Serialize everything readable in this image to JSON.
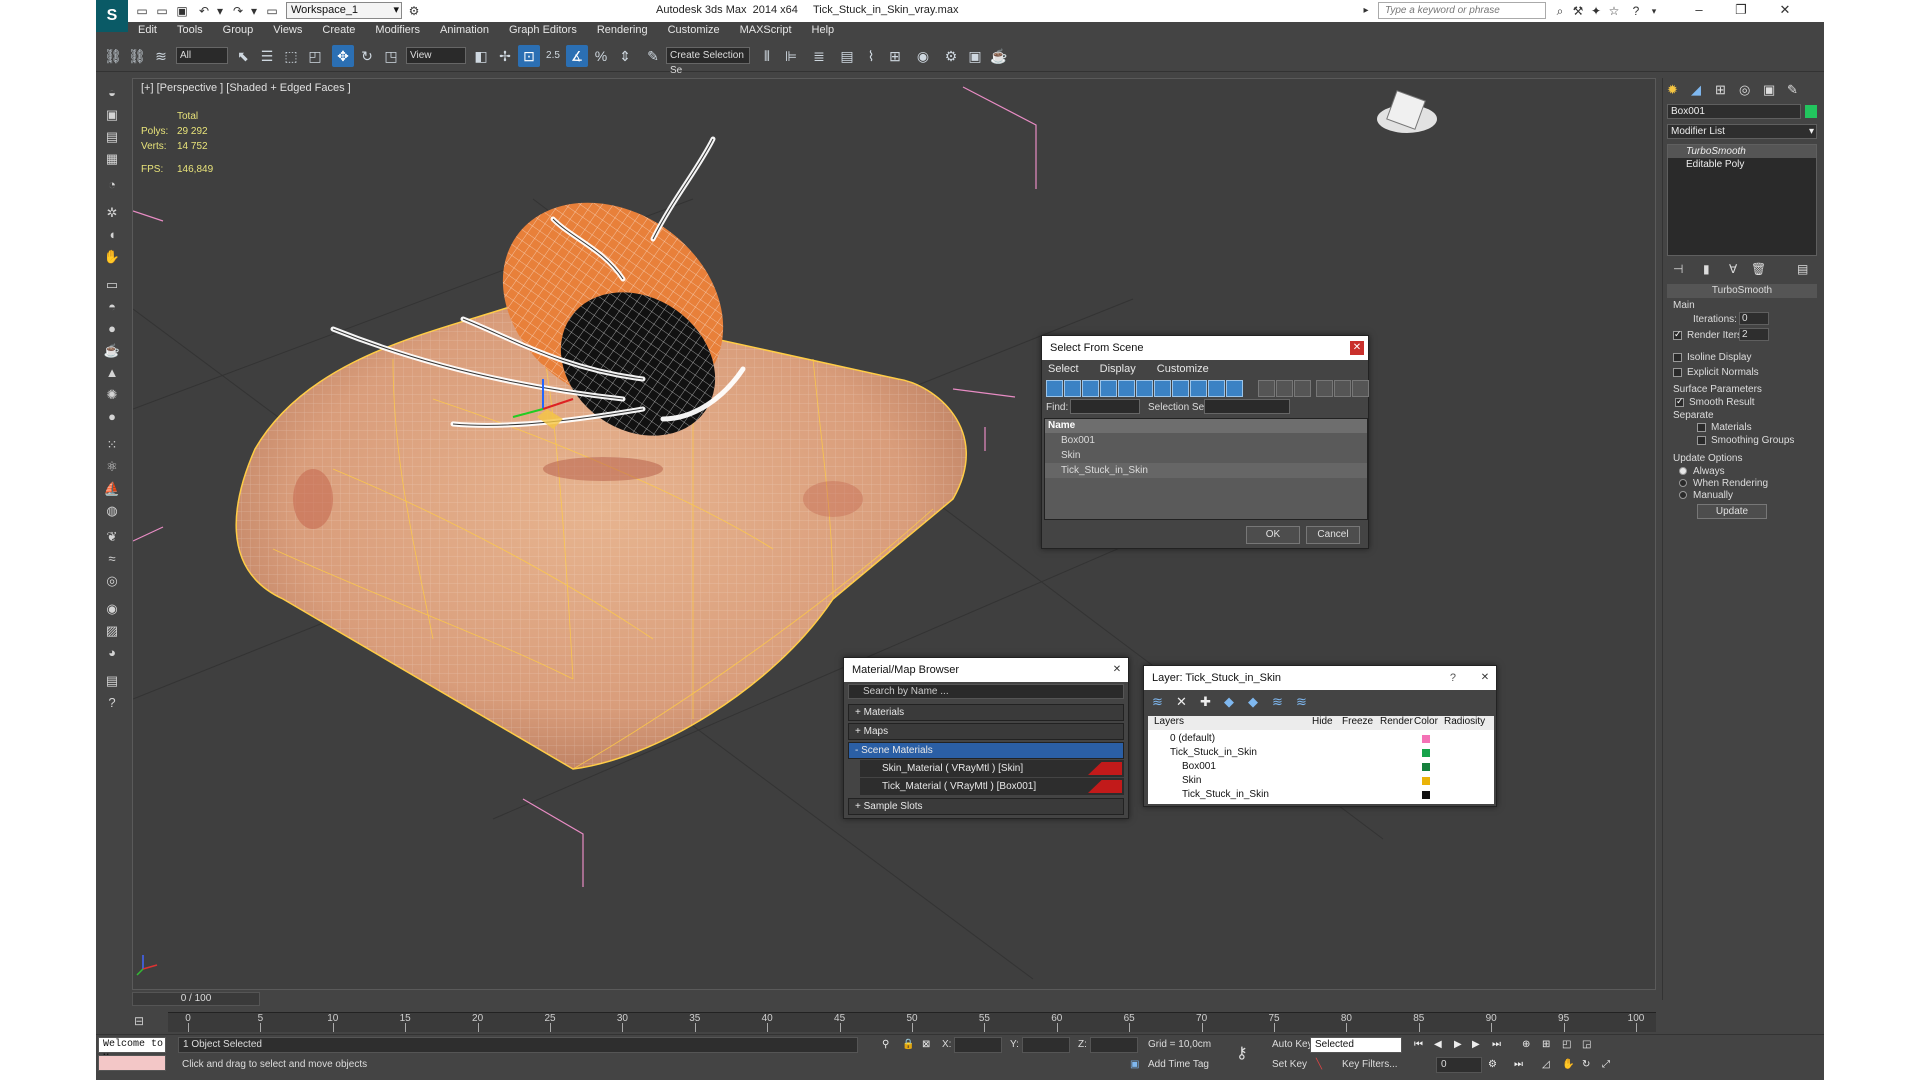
{
  "app": {
    "title": "Autodesk 3ds Max  2014 x64     Tick_Stuck_in_Skin_vray.max",
    "workspace": "Workspace_1",
    "search_placeholder": "Type a keyword or phrase"
  },
  "menu": [
    "Edit",
    "Tools",
    "Group",
    "Views",
    "Create",
    "Modifiers",
    "Animation",
    "Graph Editors",
    "Rendering",
    "Customize",
    "MAXScript",
    "Help"
  ],
  "toolbar": {
    "filter": "All",
    "ref_coord": "View",
    "snap_angle": "2.5",
    "selection_set": "Create Selection Se"
  },
  "viewport": {
    "label": "[+] [Perspective ] [Shaded + Edged Faces ]",
    "stats": {
      "header": "Total",
      "polys_label": "Polys:",
      "polys": "29 292",
      "verts_label": "Verts:",
      "verts": "14 752",
      "fps_label": "FPS:",
      "fps": "146,849"
    }
  },
  "command_panel": {
    "object_name": "Box001",
    "object_color": "#22c55e",
    "modifier_list": "Modifier List",
    "stack": [
      "TurboSmooth",
      "Editable Poly"
    ],
    "rollout_title": "TurboSmooth",
    "main_label": "Main",
    "iterations_label": "Iterations:",
    "iterations": "0",
    "render_iters_label": "Render Iters:",
    "render_iters": "2",
    "isoline": "Isoline Display",
    "explicit_normals": "Explicit Normals",
    "surface_params": "Surface Parameters",
    "smooth_result": "Smooth Result",
    "separate": "Separate",
    "materials": "Materials",
    "smoothing_groups": "Smoothing Groups",
    "update_options": "Update Options",
    "always": "Always",
    "when_rendering": "When Rendering",
    "manually": "Manually",
    "update_btn": "Update"
  },
  "select_from_scene": {
    "title": "Select From Scene",
    "menu": [
      "Select",
      "Display",
      "Customize"
    ],
    "find_label": "Find:",
    "selection_set_label": "Selection Set:",
    "column": "Name",
    "items": [
      "Box001",
      "Skin",
      "Tick_Stuck_in_Skin"
    ],
    "ok": "OK",
    "cancel": "Cancel"
  },
  "material_browser": {
    "title": "Material/Map Browser",
    "search_placeholder": "Search by Name ...",
    "groups": [
      "+ Materials",
      "+ Maps",
      "- Scene Materials"
    ],
    "materials": [
      "Skin_Material  ( VRayMtl )  [Skin]",
      "Tick_Material  ( VRayMtl )  [Box001]"
    ],
    "sample_slots": "+ Sample Slots"
  },
  "layer_dialog": {
    "title": "Layer: Tick_Stuck_in_Skin",
    "help": "?",
    "columns": [
      "Layers",
      "Hide",
      "Freeze",
      "Render",
      "Color",
      "Radiosity"
    ],
    "rows": [
      {
        "name": "0 (default)",
        "color": "#f472b6",
        "indent": 0
      },
      {
        "name": "Tick_Stuck_in_Skin",
        "color": "#16a34a",
        "indent": 0
      },
      {
        "name": "Box001",
        "color": "#15803d",
        "indent": 1
      },
      {
        "name": "Skin",
        "color": "#eab308",
        "indent": 1
      },
      {
        "name": "Tick_Stuck_in_Skin",
        "color": "#111111",
        "indent": 1
      }
    ]
  },
  "timeline": {
    "frame": "0 / 100",
    "ticks": [
      "0",
      "5",
      "10",
      "15",
      "20",
      "25",
      "30",
      "35",
      "40",
      "45",
      "50",
      "55",
      "60",
      "65",
      "70",
      "75",
      "80",
      "85",
      "90",
      "95",
      "100"
    ]
  },
  "status": {
    "script": "Welcome to M",
    "selected": "1 Object Selected",
    "prompt": "Click and drag to select and move objects",
    "x_label": "X:",
    "y_label": "Y:",
    "z_label": "Z:",
    "grid": "Grid = 10,0cm",
    "add_time_tag": "Add Time Tag",
    "auto_key": "Auto Key",
    "selected_dd": "Selected",
    "set_key": "Set Key",
    "key_filters": "Key Filters...",
    "frame_field": "0"
  }
}
